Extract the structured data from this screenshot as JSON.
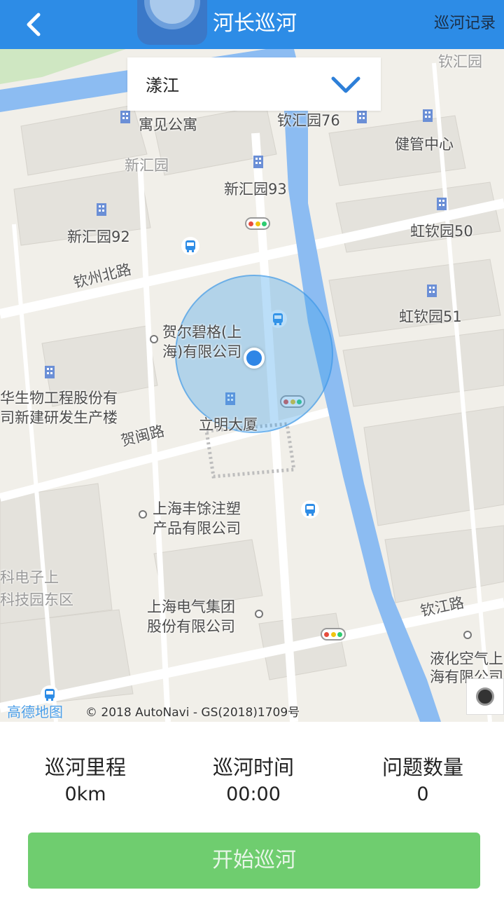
{
  "header": {
    "title": "河长巡河",
    "records_label": "巡河记录"
  },
  "river_select": {
    "value": "漾江"
  },
  "map": {
    "pois": {
      "yujian": "寓见公寓",
      "qinhuiyuan76": "钦汇园76",
      "qinhuiyuan": "钦汇园",
      "jianguan": "健管中心",
      "xinhuiyuan_area": "新汇园",
      "xinhuiyuan93": "新汇园93",
      "xinhuiyuan92": "新汇园92",
      "hongqin50": "虹钦园50",
      "hongqin51": "虹钦园51",
      "heer1": "贺尔碧格(上",
      "heer2": "海)有限公司",
      "huasheng1": "华生物工程股份有",
      "huasheng2": "司新建研发生产楼",
      "liming": "立明大厦",
      "fengyu1": "上海丰馀注塑",
      "fengyu2": "产品有限公司",
      "keji1": "科电子上",
      "keji2": "科技园东区",
      "dianqi1": "上海电气集团",
      "dianqi2": "股份有限公司",
      "yehua1": "液化空气上",
      "yehua2": "海有限公司"
    },
    "roads": {
      "qinzhou": "钦州北路",
      "hemin": "贺闽路",
      "qinjiang": "钦江路"
    },
    "attribution_logo": "高德地图",
    "copyright": "© 2018 AutoNavi - GS(2018)1709号",
    "colors": {
      "river": "#8cbcf2",
      "accuracy": "#3ca0eb",
      "location": "#2f86e6"
    }
  },
  "stats": [
    {
      "label": "巡河里程",
      "value": "0km"
    },
    {
      "label": "巡河时间",
      "value": "00:00"
    },
    {
      "label": "问题数量",
      "value": "0"
    }
  ],
  "start_button": {
    "label": "开始巡河",
    "color": "#6fcd6f"
  },
  "icons": {
    "back": "chevron-left-icon",
    "dropdown": "chevron-down-icon",
    "building": "building-icon",
    "bus": "bus-stop-icon",
    "signal": "traffic-light-icon",
    "locate": "locate-icon"
  }
}
